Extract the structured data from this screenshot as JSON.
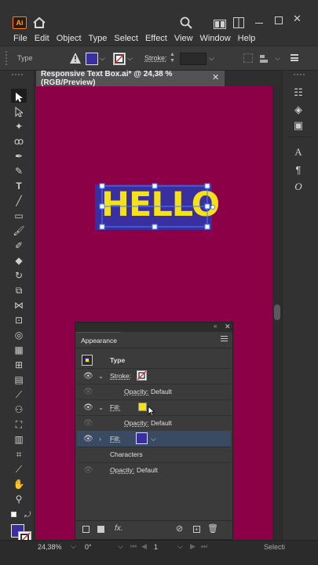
{
  "app": {
    "logo": "Ai"
  },
  "menu": [
    "File",
    "Edit",
    "Object",
    "Type",
    "Select",
    "Effect",
    "View",
    "Window",
    "Help"
  ],
  "control": {
    "type_label": "Type",
    "stroke_label": "Stroke:"
  },
  "document": {
    "tab_title": "Responsive Text Box.ai* @ 24,38 % (RGB/Preview)",
    "close": "✕"
  },
  "artwork": {
    "text": "HELLO",
    "text_color": "#f5e11a",
    "box_color": "#3a2fa0",
    "canvas_color": "#8c0047"
  },
  "appearance": {
    "tab_label": "Appearance",
    "header": "Type",
    "rows": {
      "stroke_label": "Stroke:",
      "opacity1_label": "Opacity:",
      "opacity1_value": "Default",
      "fill1_label": "Fill:",
      "opacity2_label": "Opacity:",
      "opacity2_value": "Default",
      "fill2_label": "Fill:",
      "characters_label": "Characters",
      "opacity3_label": "Opacity:",
      "opacity3_value": "Default"
    },
    "fx_label": "fx."
  },
  "status": {
    "zoom": "24,38%",
    "rotation": "0°",
    "artboard": "1",
    "tool": "Selecti"
  }
}
